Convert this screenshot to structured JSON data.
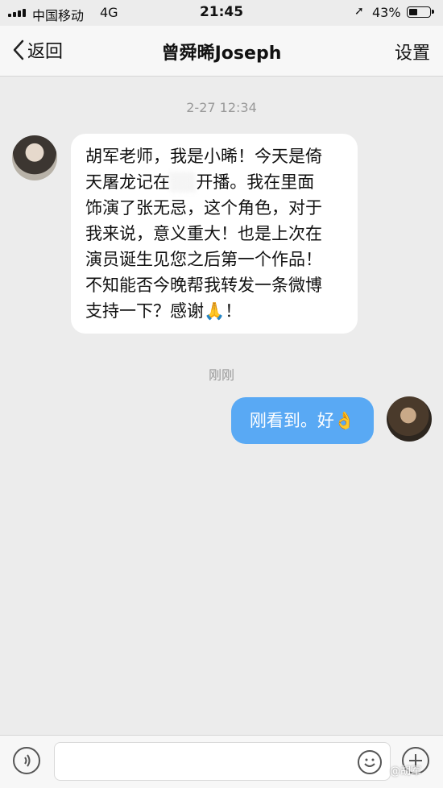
{
  "status_bar": {
    "carrier": "中国移动",
    "network": "4G",
    "time": "21:45",
    "battery": "43%",
    "battery_level": 0.43
  },
  "nav": {
    "back_label": "返回",
    "title": "曾舜晞Joseph",
    "settings_label": "设置"
  },
  "messages": [
    {
      "timestamp": "2-27 12:34",
      "side": "left",
      "lines": [
        "胡军老师，我是小晞！今天是倚",
        "天屠龙记在",
        "开播。我在里面",
        "饰演了张无忌，这个角色，对于",
        "我来说，意义重大！也是上次在",
        "演员诞生见您之后第一个作品！",
        "不知能否今晚帮我转发一条微博",
        "支持一下？感谢🙏！"
      ]
    },
    {
      "timestamp": "刚刚",
      "side": "right",
      "text": "刚看到。好👌"
    }
  ],
  "watermark": "@胡军"
}
